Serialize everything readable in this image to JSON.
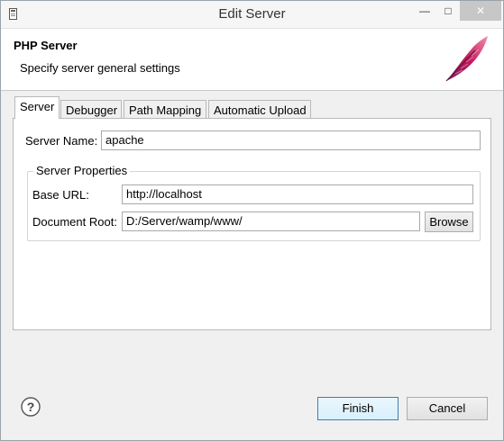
{
  "window": {
    "title": "Edit Server",
    "minimize_glyph": "—",
    "maximize_glyph": "□",
    "close_glyph": "✕"
  },
  "banner": {
    "title": "PHP Server",
    "description": "Specify server general settings",
    "logo_icon": "apache-feather-icon"
  },
  "tabs": [
    {
      "label": "Server",
      "active": true
    },
    {
      "label": "Debugger",
      "active": false
    },
    {
      "label": "Path Mapping",
      "active": false
    },
    {
      "label": "Automatic Upload",
      "active": false
    }
  ],
  "server_tab": {
    "server_name_label": "Server Name:",
    "server_name_value": "apache",
    "properties_group_title": "Server Properties",
    "base_url_label": "Base URL:",
    "base_url_value": "http://localhost",
    "document_root_label": "Document Root:",
    "document_root_value": "D:/Server/wamp/www/",
    "browse_label": "Browse"
  },
  "footer": {
    "help_icon": "help-icon",
    "finish_label": "Finish",
    "cancel_label": "Cancel"
  }
}
